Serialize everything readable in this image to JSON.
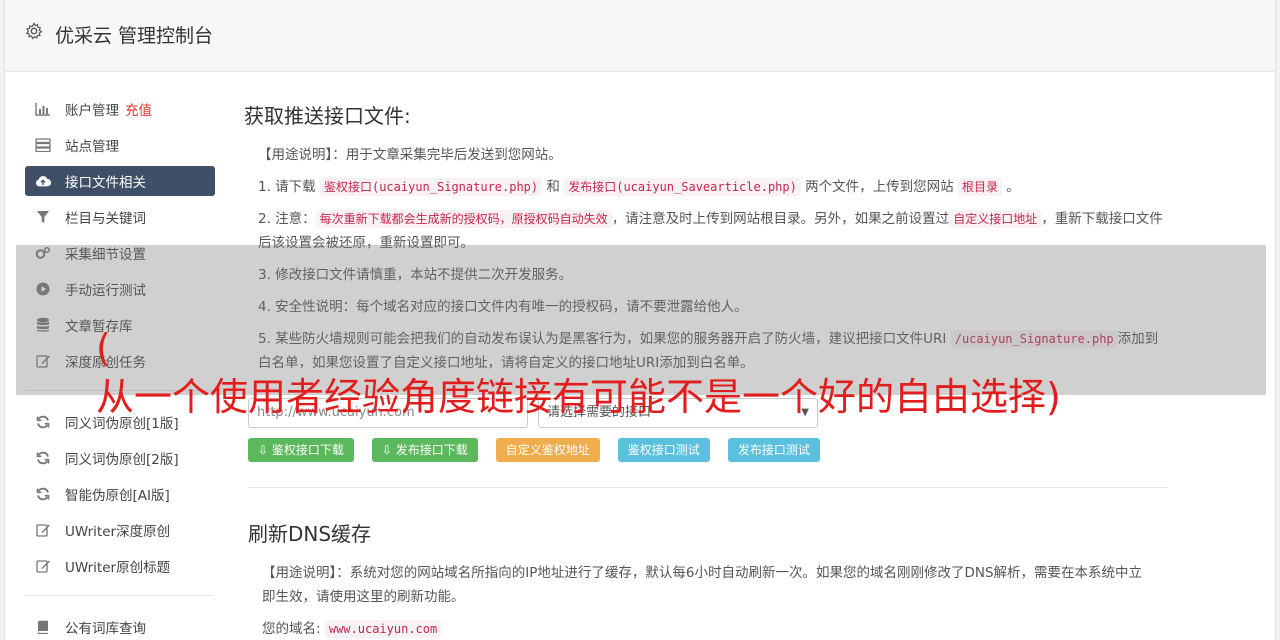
{
  "header": {
    "title": "优采云 管理控制台",
    "icon": "gear-icon"
  },
  "sidebar": {
    "group1": [
      {
        "label": "账户管理",
        "extra": "充值",
        "icon": "bar-chart-icon",
        "active": false
      },
      {
        "label": "站点管理",
        "icon": "server-icon",
        "active": false
      },
      {
        "label": "接口文件相关",
        "icon": "cloud-upload-icon",
        "active": true
      },
      {
        "label": "栏目与关键词",
        "icon": "filter-icon",
        "active": false
      },
      {
        "label": "采集细节设置",
        "icon": "cogs-icon",
        "active": false
      },
      {
        "label": "手动运行测试",
        "icon": "play-icon",
        "active": false
      },
      {
        "label": "文章暂存库",
        "icon": "database-icon",
        "active": false
      },
      {
        "label": "深度原创任务",
        "icon": "edit-icon",
        "active": false
      }
    ],
    "group2": [
      {
        "label": "同义词伪原创[1版]",
        "icon": "refresh-icon"
      },
      {
        "label": "同义词伪原创[2版]",
        "icon": "refresh-icon"
      },
      {
        "label": "智能伪原创[AI版]",
        "icon": "refresh-icon"
      },
      {
        "label": "UWriter深度原创",
        "icon": "edit-icon"
      },
      {
        "label": "UWriter原创标题",
        "icon": "edit-icon"
      }
    ],
    "group3": [
      {
        "label": "公有词库查询",
        "icon": "book-icon"
      }
    ]
  },
  "main": {
    "section1_title": "获取推送接口文件:",
    "usage_label": "【用途说明】",
    "usage_text": "：用于文章采集完毕后发送到您网站。",
    "step1_a": "1. 请下载 ",
    "step1_code1": "鉴权接口(ucaiyun_Signature.php)",
    "step1_b": " 和 ",
    "step1_code2": "发布接口(ucaiyun_Savearticle.php)",
    "step1_c": " 两个文件，上传到您网站 ",
    "step1_code3": "根目录",
    "step1_d": " 。",
    "step2_a": "2. 注意：",
    "step2_code1": "每次重新下载都会生成新的授权码，原授权码自动失效",
    "step2_b": "，请注意及时上传到网站根目录。另外，如果之前设置过",
    "step2_code2": "自定义接口地址",
    "step2_c": "，重新下载接口文件后该设置会被还原，重新设置即可。",
    "step3": "3. 修改接口文件请慎重，本站不提供二次开发服务。",
    "step4": "4. 安全性说明：每个域名对应的接口文件内有唯一的授权码，请不要泄露给他人。",
    "step5_a": "5. 某些防火墙规则可能会把我们的自动发布误认为是黑客行为，如果您的服务器开启了防火墙，建议把接口文件URI ",
    "step5_code": "/ucaiyun_Signature.php",
    "step5_b": "添加到白名单，如果您设置了自定义接口地址，请将自定义的接口地址URI添加到白名单。",
    "site_input_value": "http://www.ucaiyun.com",
    "select_value": "请选择需要的接口",
    "buttons": [
      {
        "label": "鉴权接口下载",
        "icon": "download-icon",
        "style": "green"
      },
      {
        "label": "发布接口下载",
        "icon": "download-icon",
        "style": "green"
      },
      {
        "label": "自定义鉴权地址",
        "style": "orange"
      },
      {
        "label": "鉴权接口测试",
        "style": "blue"
      },
      {
        "label": "发布接口测试",
        "style": "blue"
      }
    ],
    "section2_title": "刷新DNS缓存",
    "dns_usage_label": "【用途说明】",
    "dns_usage_text": "：系统对您的网站域名所指向的IP地址进行了缓存，默认每6小时自动刷新一次。如果您的域名刚刚修改了DNS解析，需要在本系统中立即生效，请使用这里的刷新功能。",
    "domain_label": "您的域名: ",
    "domain_value": "www.ucaiyun.com"
  },
  "overlay": {
    "paren": "(",
    "text": "从一个使用者经验角度链接有可能不是一个好的自由选择)"
  },
  "colors": {
    "active_nav": "#3f4f66",
    "accent_red": "#e8352b",
    "green": "#5cb85c",
    "orange": "#f0ad4e",
    "blue": "#5bc0de"
  }
}
